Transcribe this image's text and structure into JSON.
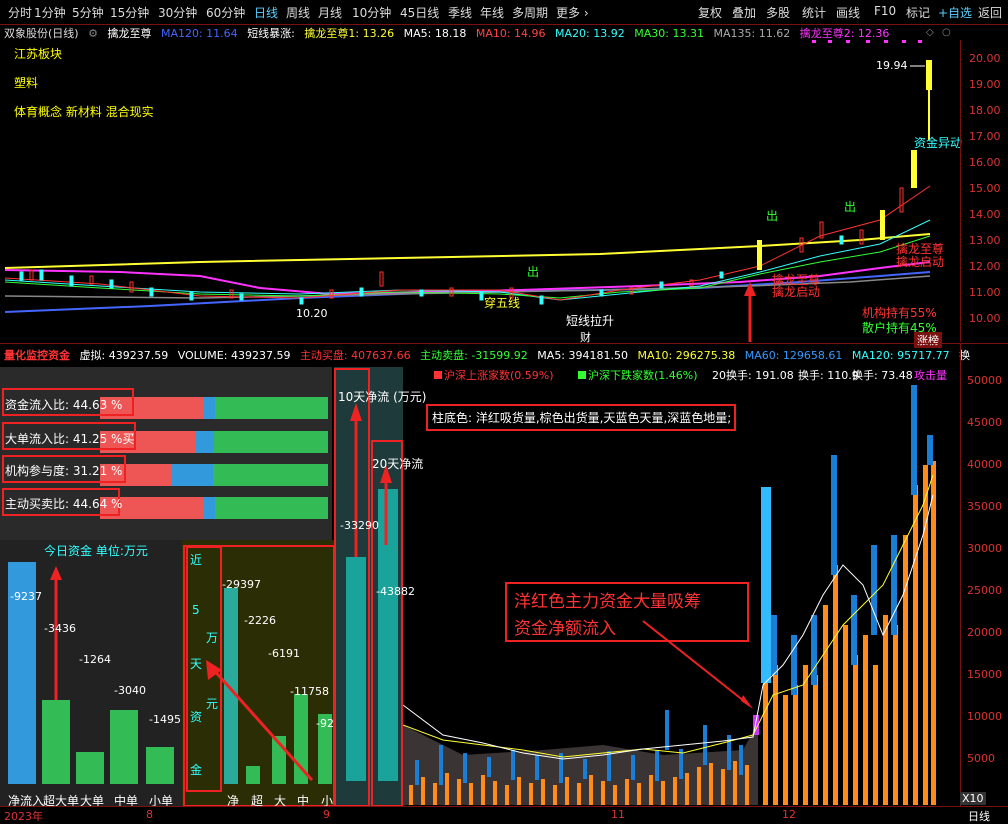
{
  "toolbar": {
    "periods": [
      "分时",
      "1分钟",
      "5分钟",
      "15分钟",
      "30分钟",
      "60分钟",
      "日线",
      "周线",
      "月线",
      "10分钟",
      "45日线",
      "季线",
      "年线",
      "多周期",
      "更多 ›"
    ],
    "selected": "日线",
    "right": [
      "复权",
      "叠加",
      "多股",
      "统计",
      "画线",
      "F10",
      "标记",
      "+自选",
      "返回"
    ]
  },
  "header": {
    "stock": "双象股份(日线)",
    "indicator": "擒龙至尊",
    "ma120": "MA120: 11.64",
    "short_label": "短线暴涨:",
    "qlzz1": "擒龙至尊1: 13.26",
    "ma5": "MA5: 18.18",
    "ma10": "MA10: 14.96",
    "ma20": "MA20: 13.92",
    "ma30": "MA30: 13.31",
    "ma135": "MA135: 11.62",
    "qlzz2": "擒龙至尊2: 12.36"
  },
  "concepts": {
    "board": "江苏板块",
    "industry": "塑料",
    "tags": "体育概念 新材料 混合现实"
  },
  "price_chart": {
    "axis": [
      "20.00",
      "19.00",
      "18.00",
      "17.00",
      "16.00",
      "15.00",
      "14.00",
      "13.00",
      "12.00",
      "11.00",
      "10.00"
    ],
    "high": "19.94",
    "low": "10.20",
    "annotations": {
      "chu1": "出",
      "chu2": "出",
      "chu3": "出",
      "chuanwuxian": "穿五线",
      "duanxian": "短线拉升",
      "cai": "财",
      "zijin": "资金异动",
      "qlzz": "擒龙至尊",
      "qldq": "擒龙启动",
      "qlzz_b": "擒龙至尊",
      "qldq_b": "擒龙启动",
      "jigou": "机构持有55%",
      "sanhu": "散户持有45%",
      "zhangbang": "涨榜"
    }
  },
  "lower": {
    "title": "量化监控资金",
    "xuni": "虚拟: 439237.59",
    "volume": "VOLUME: 439237.59",
    "zhudong_buy": "主动买盘: 407637.66",
    "zhudong_sell": "主动卖盘: -31599.92",
    "ma5": "MA5: 394181.50",
    "ma10": "MA10: 296275.38",
    "ma60": "MA60: 129658.61",
    "ma120": "MA120: 95717.77",
    "more": "换",
    "legend_up": "沪深上涨家数(0.59%)",
    "legend_down": "沪深下跌家数(1.46%)",
    "huanshou1": "20换手: 191.08",
    "huanshou2": "换手: 110.9",
    "huanshou3": "换手: 73.48",
    "attack": "攻击量",
    "note": "柱底色: 洋红吸货量,棕色出货量,天蓝色天量,深蓝色地量;",
    "callout_l1": "洋红色主力资金大量吸筹",
    "callout_l2": "资金净额流入",
    "x10": "X10",
    "axis": [
      "50000",
      "45000",
      "40000",
      "35000",
      "30000",
      "25000",
      "20000",
      "15000",
      "10000",
      "5000"
    ],
    "ratios": [
      {
        "label": "资金流入比: 44.63 %",
        "red": 0.45
      },
      {
        "label": "大单流入比: 41.25 %",
        "red": 0.42,
        "tag": "买"
      },
      {
        "label": "机构参与度: 31.21 %",
        "red": 0.31
      },
      {
        "label": "主动买卖比: 44.64 %",
        "red": 0.45
      }
    ],
    "today": {
      "title": "今日资金 单位:万元",
      "values": [
        "-9237",
        "-3436",
        "-1264",
        "-3040",
        "-1495"
      ],
      "labels": [
        "净流入",
        "超大单",
        "大单",
        "中单",
        "小单"
      ]
    },
    "five_day": {
      "vertical": [
        "近",
        "5",
        "万",
        "天",
        "元",
        "资",
        "金"
      ],
      "values": [
        "-29397",
        "-2226",
        "-6191",
        "-11758",
        "-92"
      ],
      "labels": [
        "净",
        "超",
        "大",
        "中",
        "小"
      ]
    },
    "ten_day": {
      "title": "10天净流 (万元)",
      "value": "-33290"
    },
    "twenty_day": {
      "title": "20天净流",
      "value": "-43882"
    }
  },
  "bottom_axis": {
    "labels": [
      "2023年",
      "8",
      "9",
      "11",
      "12"
    ],
    "right": "日线"
  }
}
